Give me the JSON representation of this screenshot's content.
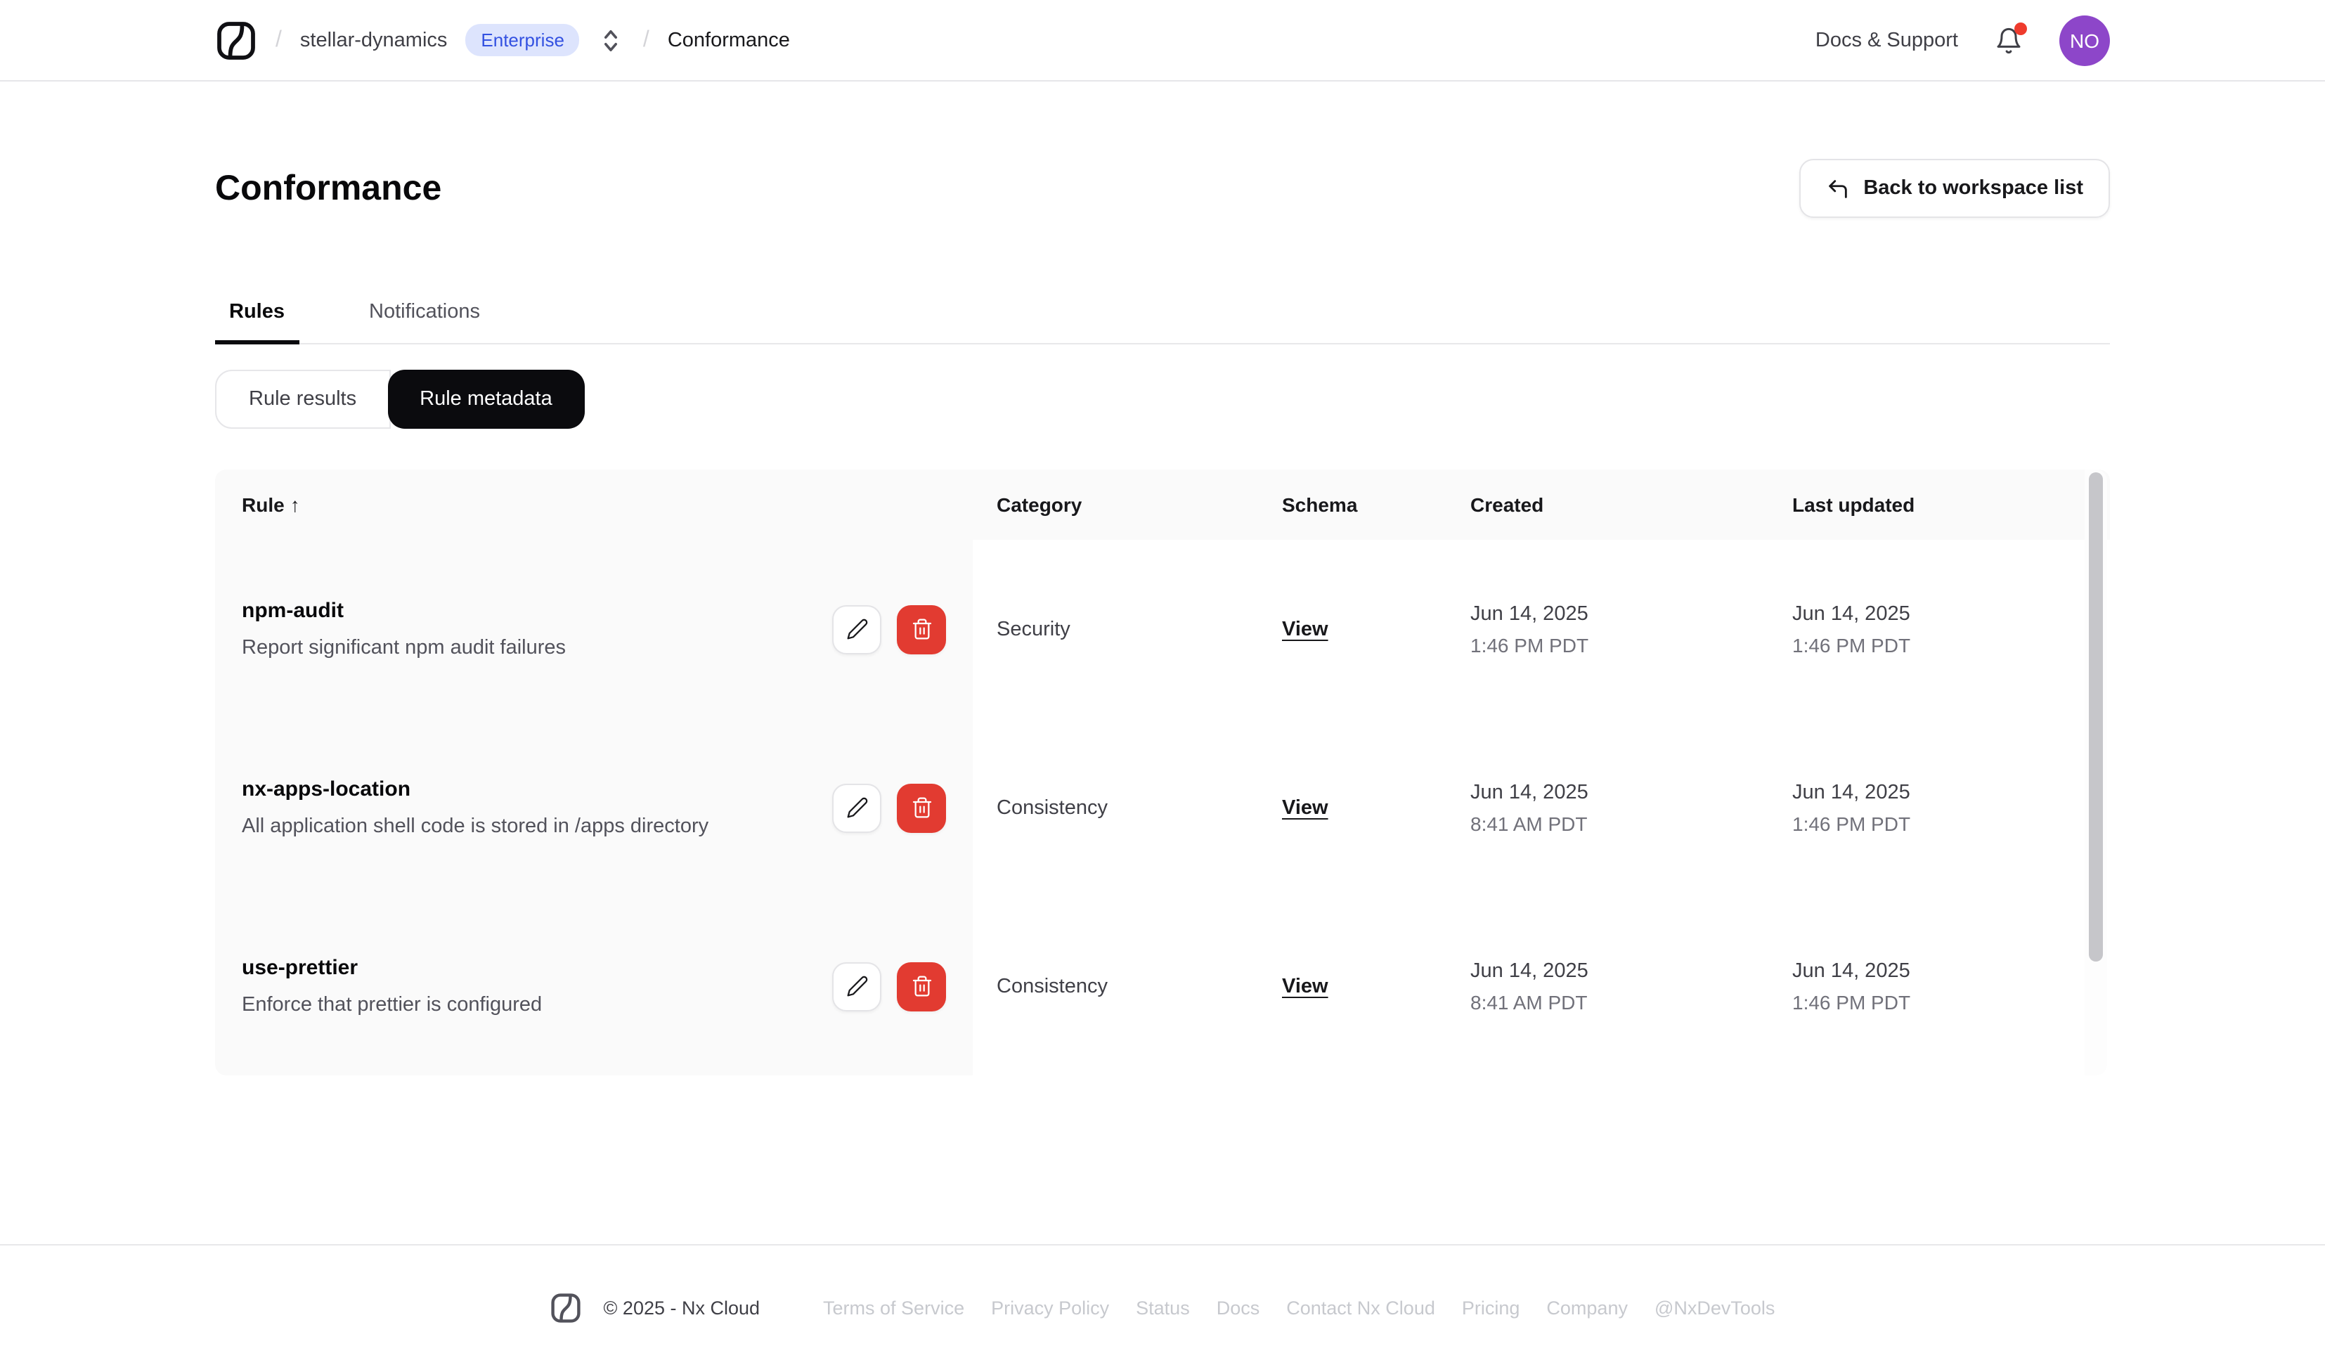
{
  "topbar": {
    "workspace": "stellar-dynamics",
    "plan_badge": "Enterprise",
    "current_page": "Conformance",
    "docs_support_label": "Docs & Support",
    "avatar_initials": "NO"
  },
  "page": {
    "title": "Conformance",
    "back_button_label": "Back to workspace list"
  },
  "tabs": [
    {
      "label": "Rules",
      "active": true
    },
    {
      "label": "Notifications",
      "active": false
    }
  ],
  "view_toggle": [
    {
      "label": "Rule results",
      "active": false
    },
    {
      "label": "Rule metadata",
      "active": true
    }
  ],
  "table": {
    "columns": [
      "Rule",
      "Category",
      "Schema",
      "Created",
      "Last updated"
    ],
    "sort_arrow": "↑",
    "view_link_label": "View",
    "rows": [
      {
        "name": "npm-audit",
        "description": "Report significant npm audit failures",
        "category": "Security",
        "created_date": "Jun 14, 2025",
        "created_time": "1:46 PM PDT",
        "updated_date": "Jun 14, 2025",
        "updated_time": "1:46 PM PDT"
      },
      {
        "name": "nx-apps-location",
        "description": "All application shell code is stored in /apps directory",
        "category": "Consistency",
        "created_date": "Jun 14, 2025",
        "created_time": "8:41 AM PDT",
        "updated_date": "Jun 14, 2025",
        "updated_time": "1:46 PM PDT"
      },
      {
        "name": "use-prettier",
        "description": "Enforce that prettier is configured",
        "category": "Consistency",
        "created_date": "Jun 14, 2025",
        "created_time": "8:41 AM PDT",
        "updated_date": "Jun 14, 2025",
        "updated_time": "1:46 PM PDT"
      }
    ]
  },
  "footer": {
    "copyright": "© 2025 - Nx Cloud",
    "links": [
      "Terms of Service",
      "Privacy Policy",
      "Status",
      "Docs",
      "Contact Nx Cloud",
      "Pricing",
      "Company",
      "@NxDevTools"
    ]
  },
  "colors": {
    "badge-bg": "#dde4fd",
    "badge-text": "#3351e1",
    "danger": "#e23b31",
    "avatar": "#8d46c9",
    "pill-active": "#0b0b0e",
    "notification-dot": "#ef3b2d"
  }
}
